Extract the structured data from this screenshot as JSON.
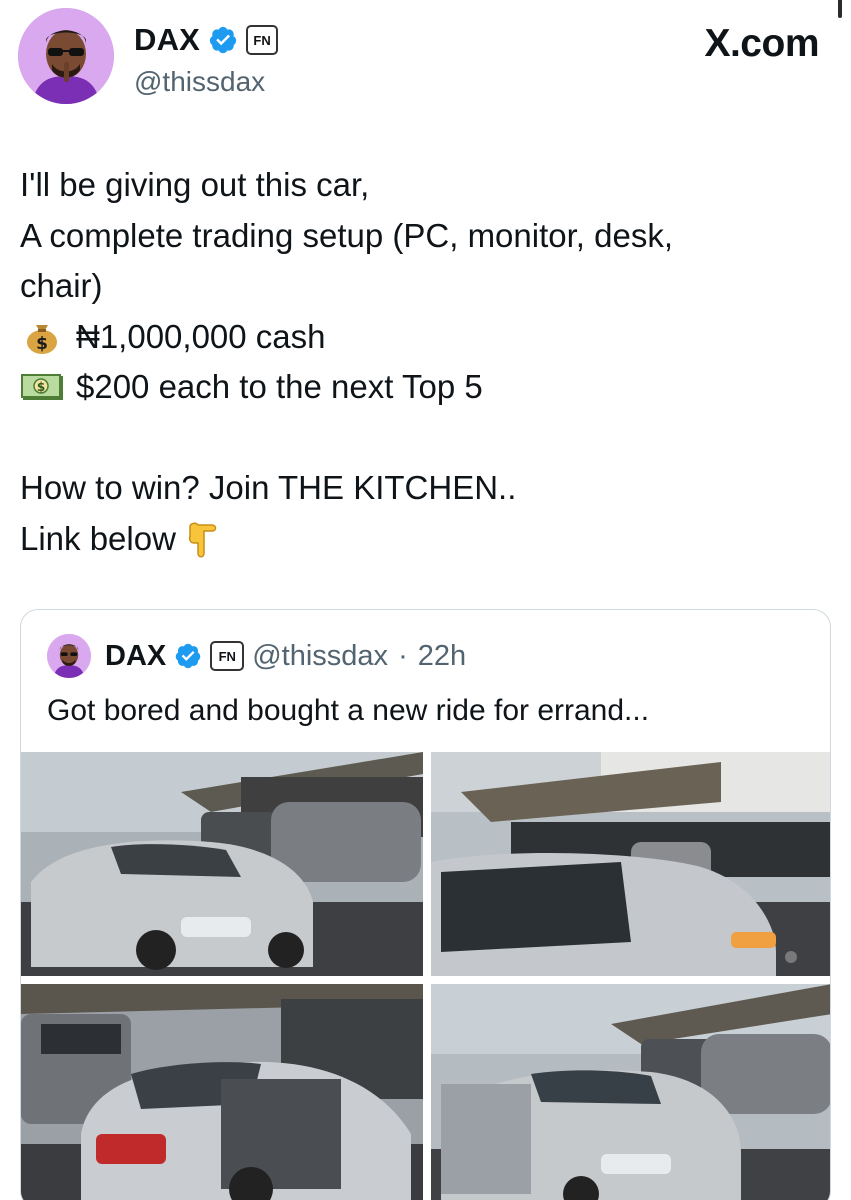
{
  "author": {
    "display_name": "DAX",
    "handle": "@thissdax",
    "affiliate_badge": "FN",
    "verified": true
  },
  "brand": "X.com",
  "tweet": {
    "lines": [
      "I'll be giving out this car,",
      "A complete trading setup (PC, monitor, desk,",
      "chair)",
      "₦1,000,000 cash",
      "$200 each to the next Top 5",
      "",
      "How to win? Join THE KITCHEN..",
      "Link below"
    ],
    "emoji": {
      "money_bag": "money-bag-icon",
      "dollar_banknote": "dollar-banknote-icon",
      "pointing_down": "backhand-index-pointing-down-icon"
    }
  },
  "quote": {
    "display_name": "DAX",
    "affiliate_badge": "FN",
    "handle": "@thissdax",
    "separator": "·",
    "time": "22h",
    "text": "Got bored and bought a new ride for errand...",
    "photos": [
      "Silver sedan in front of a dark SUV and grey coupe under a carport",
      "Silver sedan with driver door window, grey coupe behind",
      "Silver sedan with front doors open beside a grey van",
      "Silver sedan with doors open, grey coupe and SUV behind"
    ]
  },
  "colors": {
    "verified_blue": "#1d9bf0",
    "secondary_text": "#536471",
    "card_border": "#cfd9de",
    "avatar_bg": "#d9a8ee"
  }
}
